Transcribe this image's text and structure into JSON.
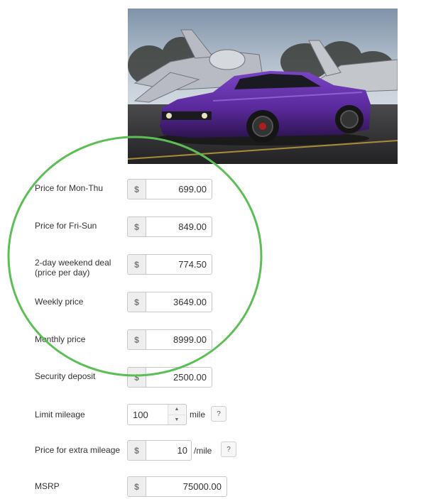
{
  "photo": {
    "alt": "Purple sports car parked in front of aircraft",
    "colors": {
      "car": "#5a2a9c",
      "sky": "#c9d2dc",
      "ground": "#2d2d2f"
    }
  },
  "currency_symbol": "$",
  "rows": {
    "mon_thu": {
      "label": "Price for Mon-Thu",
      "value": "699.00"
    },
    "fri_sun": {
      "label": "Price for Fri-Sun",
      "value": "849.00"
    },
    "weekend": {
      "label": "2-day weekend deal\n(price per day)",
      "value": "774.50"
    },
    "weekly": {
      "label": "Weekly price",
      "value": "3649.00"
    },
    "monthly": {
      "label": "Monthly price",
      "value": "8999.00"
    },
    "deposit": {
      "label": "Security deposit",
      "value": "2500.00"
    },
    "mileage": {
      "label": "Limit mileage",
      "value": "100",
      "unit": "mile",
      "help": "?"
    },
    "extra_mileage": {
      "label": "Price for extra mileage",
      "value": "10",
      "unit": "/mile",
      "help": "?"
    },
    "msrp": {
      "label": "MSRP",
      "value": "75000.00"
    }
  },
  "highlight_color": "#5cbf55"
}
